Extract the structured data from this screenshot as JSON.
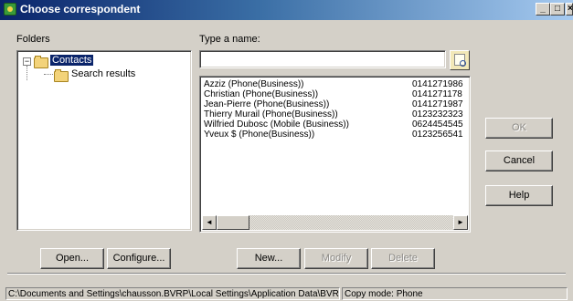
{
  "window": {
    "title": "Choose correspondent",
    "min_glyph": "_",
    "max_glyph": "□",
    "close_glyph": "×"
  },
  "folders": {
    "label": "Folders",
    "tree": [
      {
        "label": "Contacts",
        "expander": "−",
        "selected": true
      },
      {
        "label": "Search results",
        "selected": false
      }
    ]
  },
  "search": {
    "label": "Type a name:",
    "value": ""
  },
  "contacts": [
    {
      "name": "Azziz (Phone(Business))",
      "phone": "0141271986"
    },
    {
      "name": "Christian (Phone(Business))",
      "phone": "0141271178"
    },
    {
      "name": "Jean-Pierre (Phone(Business))",
      "phone": "0141271987"
    },
    {
      "name": "Thierry Murail (Phone(Business))",
      "phone": "0123232323"
    },
    {
      "name": "Wilfried Dubosc (Mobile (Business))",
      "phone": "0624454545"
    },
    {
      "name": "Yveux $ (Phone(Business))",
      "phone": "0123256541"
    }
  ],
  "scroll": {
    "left": "◄",
    "right": "►"
  },
  "buttons": {
    "ok": "OK",
    "cancel": "Cancel",
    "help": "Help",
    "open": "Open...",
    "configure": "Configure...",
    "new": "New...",
    "modify": "Modify",
    "delete": "Delete"
  },
  "status": {
    "path": "C:\\Documents and Settings\\chausson.BVRP\\Local Settings\\Application Data\\BVRP Software\\",
    "mode": "Copy mode: Phone"
  }
}
